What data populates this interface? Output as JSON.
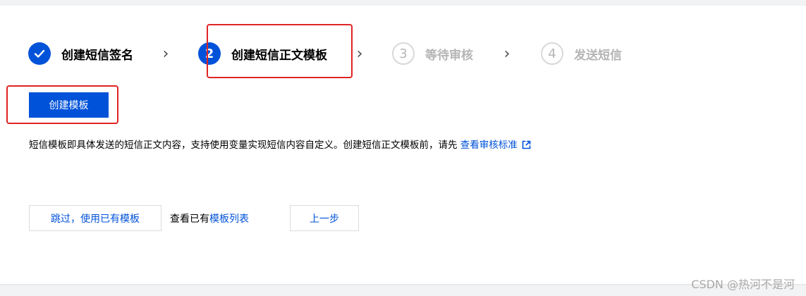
{
  "steps": [
    {
      "index": "1",
      "label": "创建短信签名",
      "state": "done"
    },
    {
      "index": "2",
      "label": "创建短信正文模板",
      "state": "active"
    },
    {
      "index": "3",
      "label": "等待审核",
      "state": "pending"
    },
    {
      "index": "4",
      "label": "发送短信",
      "state": "pending"
    }
  ],
  "create_button": "创建模板",
  "description": {
    "text": "短信模板即具体发送的短信正文内容，支持使用变量实现短信内容自定义。创建短信正文模板前，请先 ",
    "link": "查看审核标准"
  },
  "footer": {
    "skip_button": "跳过，使用已有模板",
    "view_prefix": "查看已有",
    "view_link": "模板列表",
    "prev_button": "上一步"
  },
  "watermark": "CSDN @热河不是河",
  "colors": {
    "accent": "#0052d9",
    "highlight": "#e02424"
  }
}
